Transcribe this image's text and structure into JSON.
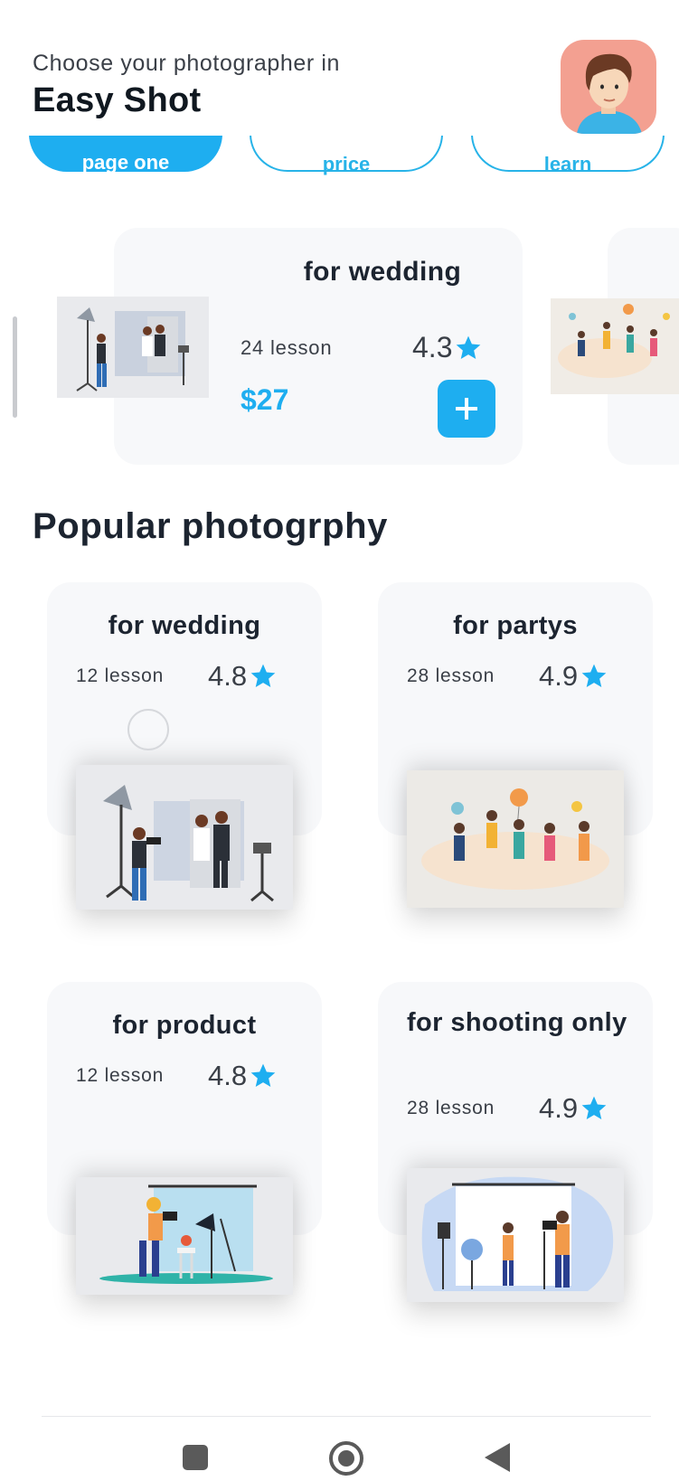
{
  "header": {
    "subtitle": "Choose your photographer in",
    "title": "Easy Shot"
  },
  "filters": [
    {
      "label": "page one"
    },
    {
      "label": "price"
    },
    {
      "label": "learn"
    }
  ],
  "featured": {
    "title": "for wedding",
    "lessons": "24 lesson",
    "rating": "4.3",
    "price": "$27",
    "add_label": "+"
  },
  "section_title": "Popular photogrphy",
  "popular": [
    {
      "title": "for wedding",
      "lessons": "12 lesson",
      "rating": "4.8"
    },
    {
      "title": "for partys",
      "lessons": "28 lesson",
      "rating": "4.9"
    },
    {
      "title": "for product",
      "lessons": "12 lesson",
      "rating": "4.8"
    },
    {
      "title": "for shooting only",
      "lessons": "28 lesson",
      "rating": "4.9"
    }
  ],
  "colors": {
    "accent": "#1eaef0",
    "card": "#f7f8fa",
    "text": "#1c2430",
    "avatar_bg": "#f3a091"
  },
  "icons": [
    "star-icon",
    "plus-icon",
    "recent-apps-icon",
    "home-icon",
    "back-icon"
  ]
}
